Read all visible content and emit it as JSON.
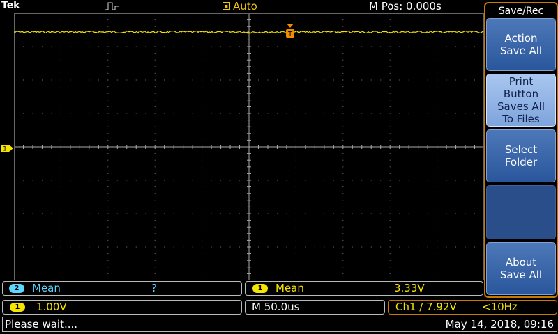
{
  "header": {
    "brand": "Tek",
    "trigger_icon": "pulse-edge-icon",
    "acquisition_icon": "acquire-icon",
    "acquisition_mode": "Auto",
    "m_pos": "M Pos: 0.000s"
  },
  "menu": {
    "title": "Save/Rec",
    "items": [
      {
        "label_line1": "Action",
        "label_line2": "Save All"
      },
      {
        "label_line1": "Print",
        "label_line2": "Button",
        "label_line3": "Saves All",
        "label_line4": "To Files"
      },
      {
        "label_line1": "Select",
        "label_line2": "Folder"
      },
      {
        "label_line1": "About",
        "label_line2": "Save All"
      }
    ]
  },
  "markers": {
    "ch1": "1",
    "trigger_icon": "trigger-position-icon"
  },
  "measurements": [
    {
      "channel": "2",
      "label": "Mean",
      "value": "?",
      "color": "#5ed7ff"
    },
    {
      "channel": "1",
      "label": "Mean",
      "value": "3.33V",
      "color": "#f5e400"
    }
  ],
  "scale": {
    "channel": "1",
    "volts_per_div": "1.00V",
    "timebase": "M 50.0us",
    "trigger_source": "Ch1 ∕ 7.92V",
    "trigger_freq": "<10Hz"
  },
  "status": {
    "message": "Please wait....",
    "datetime": "May 14, 2018, 09:16"
  },
  "colors": {
    "ch1": "#f5e400",
    "ch2": "#5ed7ff",
    "menu_accent": "#c97800"
  }
}
